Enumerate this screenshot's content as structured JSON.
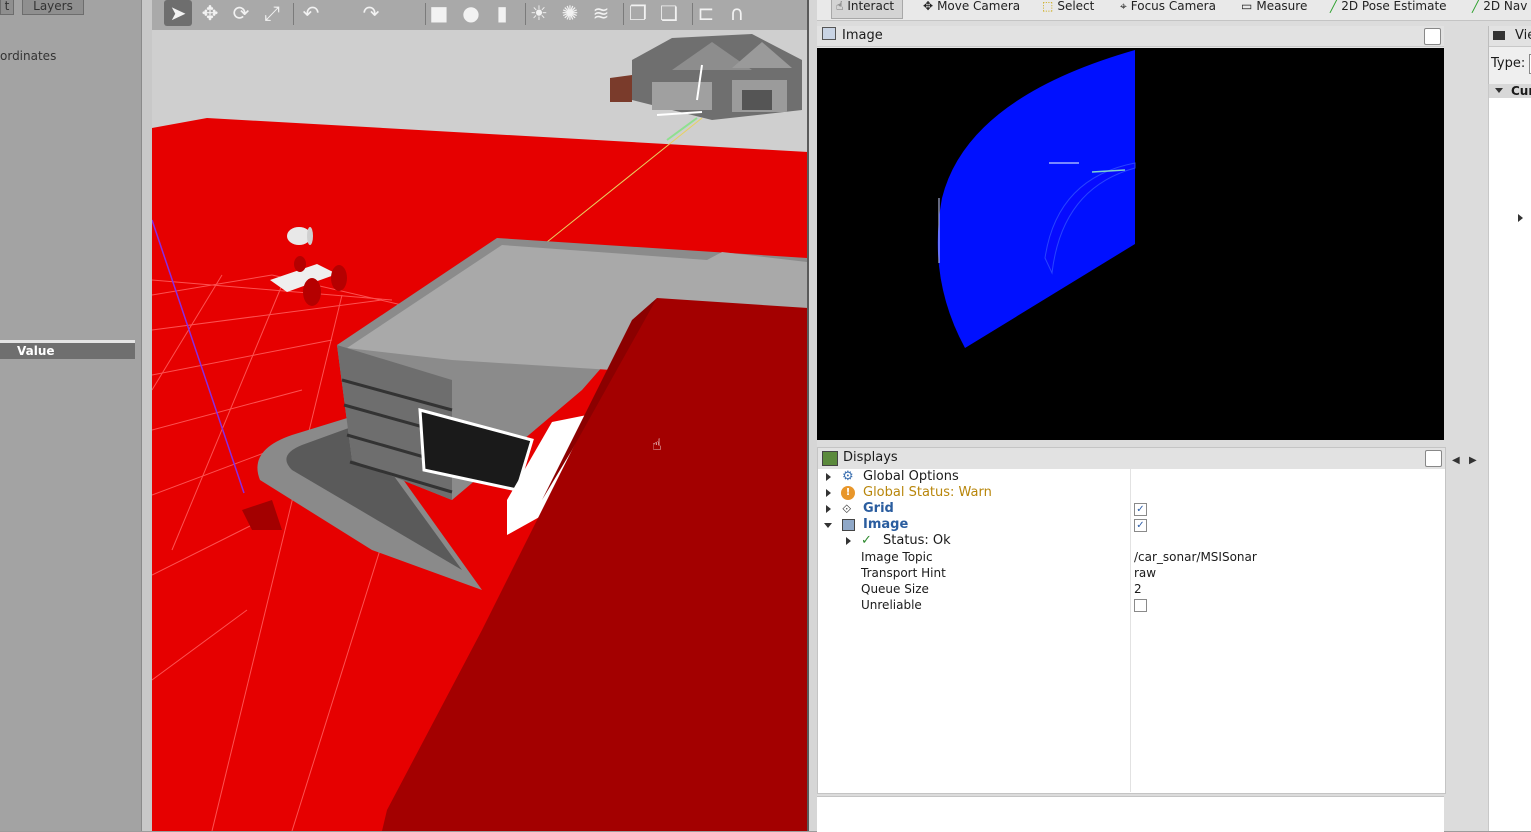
{
  "gazebo": {
    "tabs": {
      "left_tab": "t",
      "layers_tab": "Layers"
    },
    "coordinates_label": "ordinates",
    "value_header": "Value",
    "toolbar": [
      {
        "name": "select-arrow-icon",
        "glyph": "➤"
      },
      {
        "name": "translate-icon",
        "glyph": "✥"
      },
      {
        "name": "rotate-icon",
        "glyph": "⟳"
      },
      {
        "name": "scale-icon",
        "glyph": "⤢"
      },
      {
        "name": "undo-icon",
        "glyph": "↶"
      },
      {
        "name": "redo-icon",
        "glyph": "↷"
      },
      {
        "name": "box-shape-icon",
        "glyph": "■"
      },
      {
        "name": "sphere-shape-icon",
        "glyph": "●"
      },
      {
        "name": "cylinder-shape-icon",
        "glyph": "▮"
      },
      {
        "name": "point-light-icon",
        "glyph": "☀"
      },
      {
        "name": "spot-light-icon",
        "glyph": "✺"
      },
      {
        "name": "directional-light-icon",
        "glyph": "≋"
      },
      {
        "name": "copy-icon",
        "glyph": "❐"
      },
      {
        "name": "paste-icon",
        "glyph": "❏"
      },
      {
        "name": "align-icon",
        "glyph": "⊏"
      },
      {
        "name": "snap-icon",
        "glyph": "∩"
      }
    ]
  },
  "rviz": {
    "toolbar": {
      "interact": "Interact",
      "move_camera": "Move Camera",
      "select": "Select",
      "focus_camera": "Focus Camera",
      "measure": "Measure",
      "pose_estimate": "2D Pose Estimate",
      "nav_goal": "2D Nav"
    },
    "image_panel": {
      "title": "Image"
    },
    "displays_panel": {
      "title": "Displays",
      "rows": [
        {
          "label": "Global Options"
        },
        {
          "label": "Global Status: Warn"
        },
        {
          "label": "Grid"
        },
        {
          "label": "Image"
        },
        {
          "label": "Status: Ok"
        },
        {
          "label": "Image Topic",
          "value": "/car_sonar/MSISonar"
        },
        {
          "label": "Transport Hint",
          "value": "raw"
        },
        {
          "label": "Queue Size",
          "value": "2"
        },
        {
          "label": "Unreliable"
        }
      ],
      "grid_enabled": true,
      "image_enabled": true,
      "unreliable": false
    },
    "views_panel": {
      "title": "Vie",
      "type_label": "Type:",
      "current_label": "Cur"
    },
    "colors": {
      "warn": "#b8860b",
      "highlight": "#2a5d9f",
      "sonar_blue": "#0010ff",
      "floor_red": "#e60000"
    }
  }
}
